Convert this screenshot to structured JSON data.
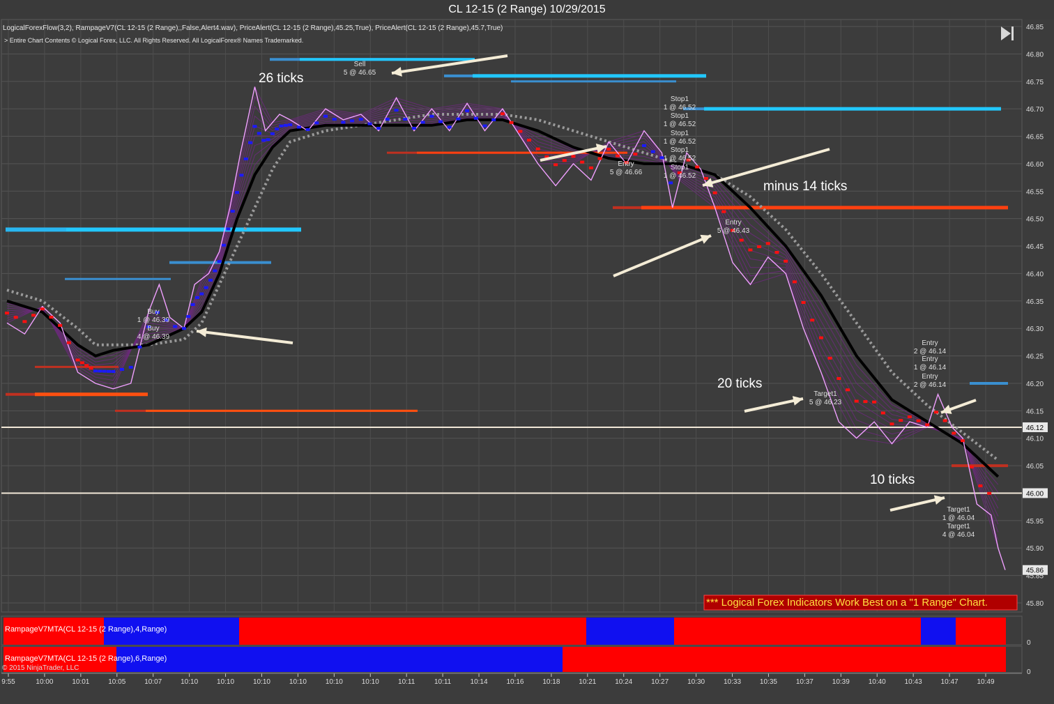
{
  "window_title": "CL 12-15 (2 Range)  10/29/2015",
  "indicators_line": "LogicalForexFlow(3,2),  RampageV7(CL 12-15 (2 Range),,False,Alert4.wav), PriceAlert(CL 12-15 (2 Range),45.25,True), PriceAlert(CL 12-15 (2 Range),45.7,True)",
  "copyright_line": "> Entire Chart Contents © Logical Forex, LLC. All Rights Reserved. All LogicalForex® Names Trademarked.",
  "banner": "*** Logical Forex Indicators Work Best on a \"1 Range\" Chart.",
  "ninjatrader_copyright": "© 2015 NinjaTrader, LLC",
  "chart_data": {
    "type": "line",
    "ylim": [
      45.78,
      46.86
    ],
    "y_ticks": [
      "46.85",
      "46.80",
      "46.75",
      "46.70",
      "46.65",
      "46.60",
      "46.55",
      "46.50",
      "46.45",
      "46.40",
      "46.35",
      "46.30",
      "46.25",
      "46.20",
      "46.15",
      "46.10",
      "46.05",
      "46.00",
      "45.95",
      "45.90",
      "45.85",
      "45.80"
    ],
    "x_labels": [
      "9:55",
      "10:00",
      "10:01",
      "10:05",
      "10:07",
      "10:10",
      "10:10",
      "10:10",
      "10:10",
      "10:10",
      "10:10",
      "10:11",
      "10:11",
      "10:14",
      "10:16",
      "10:18",
      "10:21",
      "10:24",
      "10:27",
      "10:30",
      "10:33",
      "10:35",
      "10:37",
      "10:39",
      "10:40",
      "10:43",
      "10:47",
      "10:49"
    ],
    "price_series": [
      [
        0,
        46.31
      ],
      [
        0.5,
        46.29
      ],
      [
        1,
        46.34
      ],
      [
        1.5,
        46.31
      ],
      [
        2,
        46.22
      ],
      [
        2.5,
        46.2
      ],
      [
        3,
        46.19
      ],
      [
        3.5,
        46.2
      ],
      [
        4,
        46.33
      ],
      [
        4.3,
        46.38
      ],
      [
        4.6,
        46.32
      ],
      [
        5,
        46.3
      ],
      [
        5.3,
        46.38
      ],
      [
        5.7,
        46.4
      ],
      [
        6,
        46.44
      ],
      [
        6.3,
        46.52
      ],
      [
        6.6,
        46.62
      ],
      [
        7,
        46.74
      ],
      [
        7.3,
        46.66
      ],
      [
        7.7,
        46.69
      ],
      [
        8,
        46.68
      ],
      [
        8.5,
        46.66
      ],
      [
        9,
        46.7
      ],
      [
        9.5,
        46.68
      ],
      [
        10,
        46.69
      ],
      [
        10.5,
        46.66
      ],
      [
        11,
        46.72
      ],
      [
        11.5,
        46.66
      ],
      [
        12,
        46.7
      ],
      [
        12.5,
        46.66
      ],
      [
        13,
        46.71
      ],
      [
        13.5,
        46.66
      ],
      [
        14,
        46.7
      ],
      [
        14.5,
        46.65
      ],
      [
        15,
        46.6
      ],
      [
        15.5,
        46.56
      ],
      [
        16,
        46.6
      ],
      [
        16.5,
        46.57
      ],
      [
        17,
        46.64
      ],
      [
        17.5,
        46.6
      ],
      [
        18,
        46.66
      ],
      [
        18.5,
        46.62
      ],
      [
        18.8,
        46.52
      ],
      [
        19.2,
        46.62
      ],
      [
        19.6,
        46.59
      ],
      [
        20,
        46.52
      ],
      [
        20.5,
        46.42
      ],
      [
        21,
        46.38
      ],
      [
        21.5,
        46.43
      ],
      [
        22,
        46.4
      ],
      [
        22.5,
        46.3
      ],
      [
        23,
        46.22
      ],
      [
        23.5,
        46.13
      ],
      [
        24,
        46.1
      ],
      [
        24.5,
        46.13
      ],
      [
        25,
        46.09
      ],
      [
        25.5,
        46.13
      ],
      [
        26,
        46.12
      ],
      [
        26.3,
        46.18
      ],
      [
        26.7,
        46.12
      ],
      [
        27,
        46.1
      ],
      [
        27.4,
        45.98
      ],
      [
        27.8,
        45.96
      ],
      [
        28,
        45.9
      ],
      [
        28.2,
        45.86
      ]
    ],
    "series": [
      {
        "name": "LogicalForexFlow",
        "values": [
          [
            0,
            46.35
          ],
          [
            1,
            46.33
          ],
          [
            2,
            46.27
          ],
          [
            2.5,
            46.25
          ],
          [
            3,
            46.26
          ],
          [
            4,
            46.27
          ],
          [
            5,
            46.3
          ],
          [
            5.5,
            46.33
          ],
          [
            6,
            46.4
          ],
          [
            6.5,
            46.5
          ],
          [
            7,
            46.58
          ],
          [
            7.5,
            46.63
          ],
          [
            8,
            46.66
          ],
          [
            9,
            46.67
          ],
          [
            10,
            46.67
          ],
          [
            11,
            46.67
          ],
          [
            12,
            46.67
          ],
          [
            13,
            46.68
          ],
          [
            14,
            46.68
          ],
          [
            15,
            46.66
          ],
          [
            16,
            46.63
          ],
          [
            17,
            46.61
          ],
          [
            18,
            46.6
          ],
          [
            19,
            46.6
          ],
          [
            20,
            46.58
          ],
          [
            21,
            46.52
          ],
          [
            22,
            46.45
          ],
          [
            23,
            46.36
          ],
          [
            24,
            46.25
          ],
          [
            25,
            46.17
          ],
          [
            26,
            46.13
          ],
          [
            27,
            46.09
          ],
          [
            28,
            46.03
          ]
        ]
      },
      {
        "name": "RampageV7",
        "values": [
          [
            0,
            46.37
          ],
          [
            1,
            46.35
          ],
          [
            2,
            46.3
          ],
          [
            2.5,
            46.27
          ],
          [
            3,
            46.27
          ],
          [
            4,
            46.27
          ],
          [
            5,
            46.28
          ],
          [
            5.5,
            46.31
          ],
          [
            6,
            46.38
          ],
          [
            6.5,
            46.45
          ],
          [
            7,
            46.52
          ],
          [
            7.5,
            46.59
          ],
          [
            8,
            46.64
          ],
          [
            9,
            46.66
          ],
          [
            10,
            46.67
          ],
          [
            11,
            46.68
          ],
          [
            12,
            46.69
          ],
          [
            13,
            46.69
          ],
          [
            14,
            46.69
          ],
          [
            15,
            46.68
          ],
          [
            16,
            46.66
          ],
          [
            17,
            46.64
          ],
          [
            18,
            46.62
          ],
          [
            19,
            46.6
          ],
          [
            20,
            46.58
          ],
          [
            21,
            46.54
          ],
          [
            22,
            46.48
          ],
          [
            23,
            46.4
          ],
          [
            24,
            46.31
          ],
          [
            25,
            46.22
          ],
          [
            26,
            46.16
          ],
          [
            27,
            46.11
          ],
          [
            28,
            46.06
          ]
        ]
      }
    ],
    "price_markers": [
      {
        "label": "46.12",
        "value": 46.12
      },
      {
        "label": "46.00",
        "value": 46.0
      },
      {
        "label": "45.86",
        "value": 45.86
      }
    ],
    "order_labels": [
      {
        "text": "Sell",
        "sub": "5 @ 46.65"
      },
      {
        "text": "Buy",
        "sub": "1 @ 46.39"
      },
      {
        "text": "Buy",
        "sub": "4 @ 46.39"
      },
      {
        "text": "Stop1",
        "sub": "1 @ 46.52"
      },
      {
        "text": "Stop1",
        "sub": "1 @ 46.52"
      },
      {
        "text": "Stop1",
        "sub": "1 @ 46.52"
      },
      {
        "text": "Stop1",
        "sub": "1 @ 46.52"
      },
      {
        "text": "Stop1",
        "sub": "1 @ 46.52"
      },
      {
        "text": "Entry",
        "sub": "5 @ 46.66"
      },
      {
        "text": "Entry",
        "sub": "5 @ 46.43"
      },
      {
        "text": "Target1",
        "sub": "5 @ 46.23"
      },
      {
        "text": "Entry",
        "sub": "2 @ 46.14"
      },
      {
        "text": "Entry",
        "sub": "1 @ 46.14"
      },
      {
        "text": "Entry",
        "sub": "2 @ 46.14"
      },
      {
        "text": "Target1",
        "sub": "1 @ 46.04"
      },
      {
        "text": "Target1",
        "sub": "4 @ 46.04"
      }
    ],
    "annotations": [
      "26 ticks",
      "minus 14 ticks",
      "20 ticks",
      "10 ticks"
    ]
  },
  "subpanels": [
    {
      "label": "RampageV7MTA(CL 12-15 (2 Range),4,Range)",
      "axis": "0"
    },
    {
      "label": "RampageV7MTA(CL 12-15 (2 Range),6,Range)",
      "axis": "0"
    }
  ],
  "colors": {
    "background": "#3c3c3c",
    "price": "#f0a0ff",
    "bull": "#1a1aff",
    "bear": "#ff1010",
    "flow": "#000000",
    "rampage": "#9a9a9a"
  }
}
